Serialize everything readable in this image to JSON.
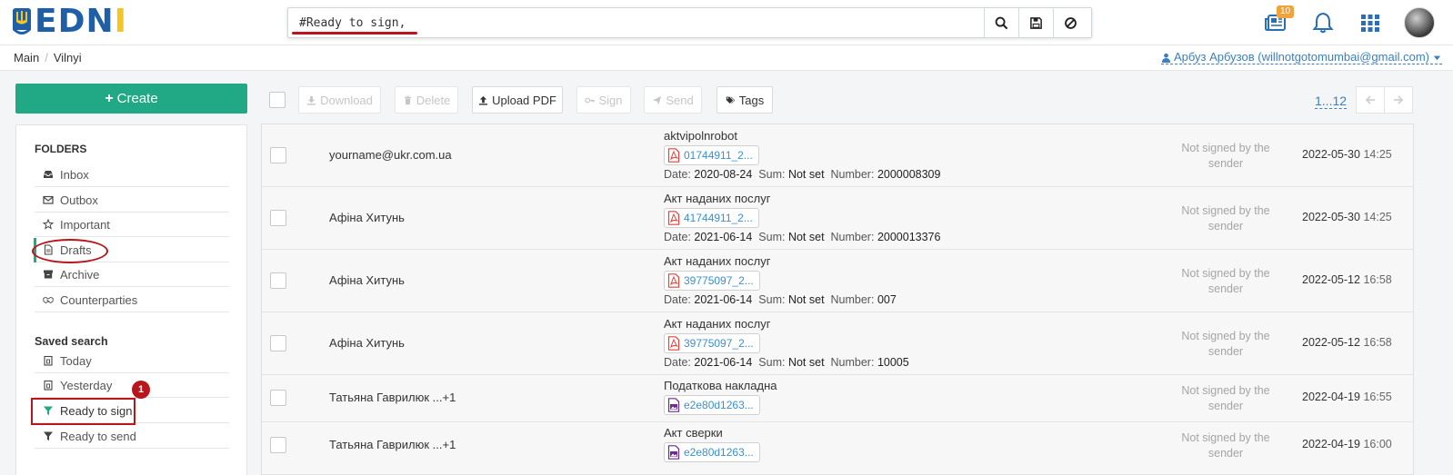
{
  "brand": {
    "logo_text_a": "ED",
    "logo_text_b": "N",
    "logo_text_c": "I"
  },
  "search": {
    "value": "#Ready to sign,",
    "placeholder": ""
  },
  "header": {
    "notifications_badge": "10"
  },
  "breadcrumb": {
    "items": [
      "Main",
      "Vilnyi"
    ]
  },
  "user": {
    "label": "Арбуз Арбузов (willnotgotomumbai@gmail.com)"
  },
  "sidebar": {
    "create_label": "Create",
    "folders_title": "FOLDERS",
    "folders": [
      {
        "label": "Inbox",
        "icon": "inbox-icon"
      },
      {
        "label": "Outbox",
        "icon": "envelope-icon"
      },
      {
        "label": "Important",
        "icon": "star-icon"
      },
      {
        "label": "Drafts",
        "icon": "file-icon"
      },
      {
        "label": "Archive",
        "icon": "archive-icon"
      },
      {
        "label": "Counterparties",
        "icon": "handshake-icon"
      }
    ],
    "saved_title": "Saved search",
    "saved": [
      {
        "label": "Today",
        "icon": "calendar-icon"
      },
      {
        "label": "Yesterday",
        "icon": "calendar-icon"
      },
      {
        "label": "Ready to sign",
        "icon": "filter-icon"
      },
      {
        "label": "Ready to send",
        "icon": "filter-icon"
      }
    ],
    "step_marker": "1"
  },
  "toolbar": {
    "download": "Download",
    "delete": "Delete",
    "upload_pdf": "Upload PDF",
    "sign": "Sign",
    "send": "Send",
    "tags": "Tags",
    "pager": "1...12"
  },
  "labels": {
    "date": "Date:",
    "sum": "Sum:",
    "number": "Number:"
  },
  "documents": [
    {
      "party": "yourname@ukr.com.ua",
      "title": "aktvipolnrobot",
      "file": "01744911_2...",
      "file_type": "pdf",
      "date": "2020-08-24",
      "sum": "Not set",
      "number": "2000008309",
      "status": "Not signed by the sender",
      "created": "2022-05-30",
      "time": "14:25"
    },
    {
      "party": "Афіна Хитунь",
      "title": "Акт наданих послуг",
      "file": "41744911_2...",
      "file_type": "pdf",
      "date": "2021-06-14",
      "sum": "Not set",
      "number": "2000013376",
      "status": "Not signed by the sender",
      "created": "2022-05-30",
      "time": "14:25"
    },
    {
      "party": "Афіна Хитунь",
      "title": "Акт наданих послуг",
      "file": "39775097_2...",
      "file_type": "pdf",
      "date": "2021-06-14",
      "sum": "Not set",
      "number": "007",
      "status": "Not signed by the sender",
      "created": "2022-05-12",
      "time": "16:58"
    },
    {
      "party": "Афіна Хитунь",
      "title": "Акт наданих послуг",
      "file": "39775097_2...",
      "file_type": "pdf",
      "date": "2021-06-14",
      "sum": "Not set",
      "number": "10005",
      "status": "Not signed by the sender",
      "created": "2022-05-12",
      "time": "16:58"
    },
    {
      "party": "Татьяна Гаврилюк ...+1",
      "title": "Податкова накладна",
      "file": "e2e80d1263...",
      "file_type": "image",
      "status": "Not signed by the sender",
      "created": "2022-04-19",
      "time": "16:55"
    },
    {
      "party": "Татьяна Гаврилюк ...+1",
      "title": "Акт сверки",
      "file": "e2e80d1263...",
      "file_type": "image",
      "status": "Not signed by the sender",
      "created": "2022-04-19",
      "time": "16:00"
    }
  ]
}
